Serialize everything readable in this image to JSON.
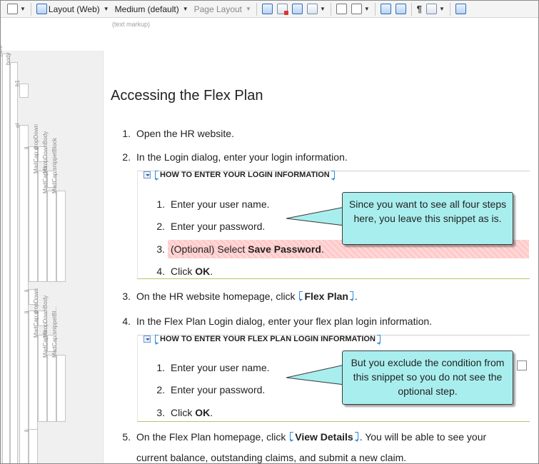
{
  "toolbar": {
    "layout_label": "Layout (Web)",
    "medium_label": "Medium (default)",
    "page_layout_label": "Page Layout",
    "pilcrow": "¶",
    "icons": [
      "search-icon",
      "ruler-icon",
      "doc-view-icon",
      "print-view-icon",
      "image-icon",
      "condition-icon",
      "formula-icon",
      "text-icon",
      "link-icon",
      "xref-icon",
      "show-tags-icon",
      "eye-icon",
      "insert-icon"
    ]
  },
  "markup_hint": "(text markup)",
  "structure": {
    "labels": [
      "html",
      "body",
      "h1",
      "ol",
      "li",
      "p",
      "MadCap:dropDown",
      "Ma...",
      "MadCap:dropDownBody",
      "MadCap:snippetBlock",
      "li",
      "li",
      "p",
      "MadCap:dropDown",
      "Ma...",
      "MadCap:dropDownBody",
      "MadCap:snippetBl...",
      "li"
    ]
  },
  "doc": {
    "title": "Accessing the Flex Plan",
    "steps": [
      {
        "num": "1.",
        "text": "Open the HR website."
      },
      {
        "num": "2.",
        "text": "In the Login dialog, enter your login information."
      },
      {
        "num": "3.",
        "pre": "On the HR website homepage, click ",
        "bold": "Flex Plan",
        "post": "."
      },
      {
        "num": "4.",
        "text": "In the Flex Plan Login dialog, enter your flex plan login information."
      },
      {
        "num": "5.",
        "pre": "On the Flex Plan homepage, click ",
        "bold": "View Details",
        "post": ". You will be able to see your",
        "line2": "current balance, outstanding claims, and submit a new claim."
      }
    ],
    "snippet1": {
      "heading": "HOW TO ENTER YOUR LOGIN INFORMATION",
      "items": [
        {
          "num": "1.",
          "text": "Enter your user name."
        },
        {
          "num": "2.",
          "text": "Enter your password."
        },
        {
          "num": "3.",
          "pre": "(Optional) Select ",
          "bold": "Save Password",
          "post": "."
        },
        {
          "num": "4.",
          "pre": "Click ",
          "bold": "OK",
          "post": "."
        }
      ]
    },
    "snippet2": {
      "heading": "HOW TO ENTER YOUR FLEX PLAN LOGIN INFORMATION",
      "items": [
        {
          "num": "1.",
          "text": "Enter your user name."
        },
        {
          "num": "2.",
          "text": "Enter your password."
        },
        {
          "num": "3.",
          "pre": "Click ",
          "bold": "OK",
          "post": "."
        }
      ]
    }
  },
  "callouts": {
    "first": "Since you want to see all four steps here, you leave this snippet as is.",
    "second": "But you exclude the condition from this snippet so you do not see the optional step."
  },
  "colors": {
    "callout_bg": "#a9eeee",
    "condition_highlight": "#ffc9c9",
    "tag_bracket": "#2d8be0"
  }
}
